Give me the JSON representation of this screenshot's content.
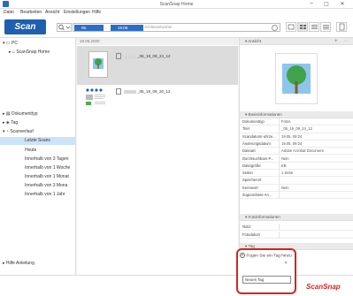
{
  "window": {
    "title": "ScanSnap Home",
    "minimize_glyph": "─",
    "maximize_glyph": "□",
    "close_glyph": "✕"
  },
  "menu": [
    {
      "label": "Datei"
    },
    {
      "label": "Bearbeiten"
    },
    {
      "label": "Ansicht"
    },
    {
      "label": "Einstellungen"
    },
    {
      "label": "Hilfe"
    }
  ],
  "toolbar": {
    "scan_label": "Scan",
    "date_from": "05.",
    "date_to": "19.05.",
    "search_placeholder": "Schlüsselwörter"
  },
  "sidebar": {
    "pc_label": "PC",
    "home_label": "ScanSnap Home",
    "filters": [
      {
        "label": "Dokumenttyp"
      },
      {
        "label": "Tag"
      },
      {
        "label": "Scanverlauf"
      }
    ],
    "history": [
      {
        "label": "Letzte Scans",
        "selected": true
      },
      {
        "label": "Heute"
      },
      {
        "label": "Innerhalb von 3 Tagen"
      },
      {
        "label": "Innerhalb von 1 Woche"
      },
      {
        "label": "Innerhalb von 1 Monat"
      },
      {
        "label": "Innerhalb von 3 Mona"
      },
      {
        "label": "Innerhalb von 1 Jahr"
      }
    ],
    "help_label": "Hilfe Anleitung"
  },
  "content": {
    "date_header": "19.05.2020",
    "rows": [
      {
        "name": "_05_19_09_24_12",
        "selected": true
      },
      {
        "name": "_05_19_09_20_12",
        "selected": false
      }
    ]
  },
  "right": {
    "preview_header": "Ansicht",
    "details_header": "Basisinformationen",
    "props": [
      {
        "key": "Dokumenttyp",
        "value": "Fotos"
      },
      {
        "key": "Titel",
        "value": "_05_19_09_24_12"
      },
      {
        "key": "Scandatum/-uhrze...",
        "value": "19.05.         09:24"
      },
      {
        "key": "Änderungsdatum",
        "value": "19.05.         09:24"
      },
      {
        "key": "Dateiart",
        "value": "Adobe Acrobat Document"
      },
      {
        "key": "Durchsuchbare P...",
        "value": "Nein"
      },
      {
        "key": "Dateigröße",
        "value": "KB"
      },
      {
        "key": "Seiten",
        "value": "1 Seite"
      },
      {
        "key": "Speicherort",
        "value": ""
      },
      {
        "key": "Kennwort",
        "value": "Nein"
      },
      {
        "key": "Zugeordnete An...",
        "value": ""
      }
    ],
    "foto_header": "Fotoinformationen",
    "foto_props": [
      {
        "key": "Notiz",
        "value": ""
      },
      {
        "key": "Fotodatum",
        "value": ""
      }
    ],
    "tag_header": "Tag"
  },
  "tag_popup": {
    "add_label": "Fügen Sie ein Tag hinzu",
    "input_value": "Neues Tag",
    "close_glyph": "✕"
  },
  "brand": "ScanSnap",
  "colors": {
    "accent": "#1e5fae",
    "highlight": "#d9231f",
    "selection": "#cde3f7"
  }
}
